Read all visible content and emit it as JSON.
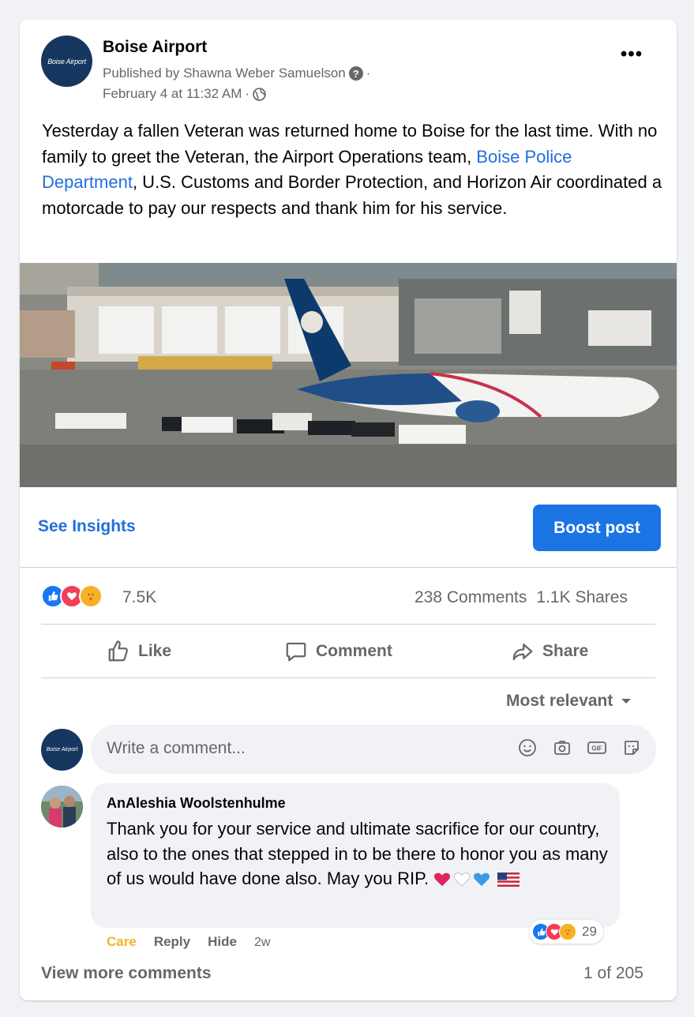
{
  "post": {
    "avatar_text": "Boise Airport",
    "page_name": "Boise Airport",
    "published_by": "Published by Shawna Weber Samuelson",
    "published_q": "?",
    "dot": "·",
    "date": "February 4 at 11:32 AM",
    "more": "•••",
    "text_part1": "Yesterday a fallen Veteran was returned home to Boise for the last time. With no family to greet the Veteran, the Airport Operations team, ",
    "text_link": "Boise Police Department",
    "text_part2": ", U.S. Customs and Border Protection, and Horizon Air coordinated a motorcade to pay our respects and thank him for his service."
  },
  "insights": {
    "see_insights": "See Insights",
    "boost": "Boost post"
  },
  "stats": {
    "reaction_count": "7.5K",
    "comments": "238 Comments",
    "shares": "1.1K Shares"
  },
  "actions": {
    "like": "Like",
    "comment": "Comment",
    "share": "Share"
  },
  "sort": {
    "label": "Most relevant"
  },
  "composer": {
    "avatar_text": "Boise Airport",
    "placeholder": "Write a comment..."
  },
  "comment": {
    "author": "AnAleshia Woolstenhulme",
    "text": "Thank you for your service and ultimate sacrifice for our country, also to the ones that stepped in to be there to honor you as many of us would have done also. May you RIP.",
    "reaction_count": "29",
    "care": "Care",
    "reply": "Reply",
    "hide": "Hide",
    "time": "2w"
  },
  "footer": {
    "view_more": "View more comments",
    "pager": "1 of 205"
  },
  "colors": {
    "link": "#216fdb",
    "boost_bg": "#1b74e4",
    "care": "#f7b125",
    "secondary_text": "#65676b"
  }
}
